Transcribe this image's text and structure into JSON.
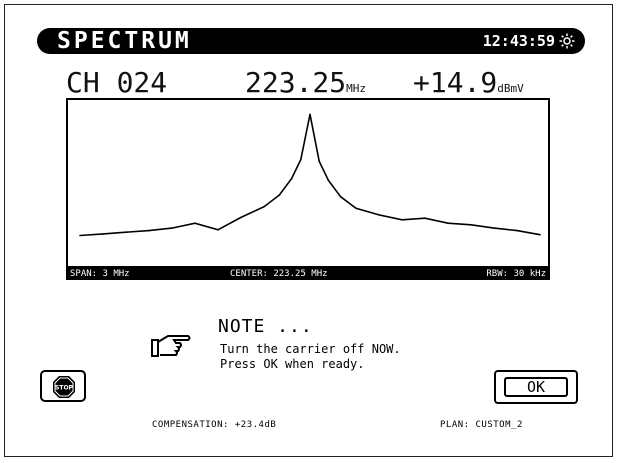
{
  "header": {
    "title": "SPECTRUM",
    "clock": "12:43:59",
    "brightness_icon": "sun-icon"
  },
  "measurement": {
    "channel": "CH 024",
    "frequency": "223.25",
    "frequency_unit": "MHz",
    "level": "+14.9",
    "level_unit": "dBmV"
  },
  "chart_data": {
    "type": "line",
    "title": "",
    "xlabel": "",
    "ylabel": "",
    "x": [
      -1.5,
      -1.35,
      -1.2,
      -1.05,
      -0.9,
      -0.75,
      -0.6,
      -0.45,
      -0.3,
      -0.2,
      -0.12,
      -0.06,
      0.0,
      0.06,
      0.12,
      0.2,
      0.3,
      0.45,
      0.6,
      0.75,
      0.9,
      1.05,
      1.2,
      1.35,
      1.5
    ],
    "y": [
      3,
      5,
      7,
      9,
      12,
      18,
      10,
      25,
      38,
      52,
      72,
      95,
      150,
      93,
      70,
      50,
      36,
      28,
      22,
      24,
      18,
      16,
      12,
      9,
      4
    ],
    "xlim": [
      -1.5,
      1.5
    ],
    "ylim": [
      0,
      160
    ],
    "grid": false,
    "color": "#000000"
  },
  "status": {
    "span": "SPAN: 3 MHz",
    "center": "CENTER: 223.25 MHz",
    "rbw": "RBW: 30 kHz"
  },
  "note": {
    "icon": "pointing-hand-icon",
    "title": "NOTE ...",
    "line1": "Turn the carrier off NOW.",
    "line2": "Press OK when ready."
  },
  "buttons": {
    "stop_icon": "stop-icon",
    "stop_label": "STOP",
    "ok_label": "OK"
  },
  "footer": {
    "compensation": "COMPENSATION: +23.4dB",
    "plan": "PLAN: CUSTOM_2"
  }
}
